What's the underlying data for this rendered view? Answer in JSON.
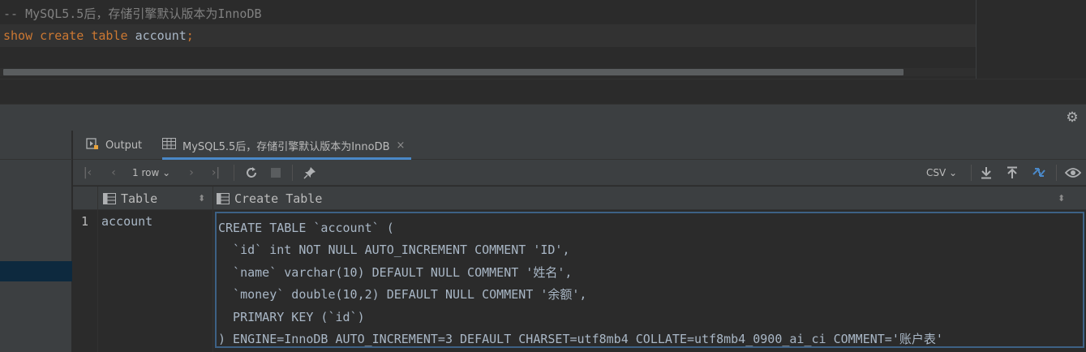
{
  "editor": {
    "comment": "-- MySQL5.5后，存储引擎默认版本为InnoDB",
    "query_kw1": "show",
    "query_kw2": "create",
    "query_kw3": "table",
    "query_ident": "account",
    "query_end": ";"
  },
  "tabs": [
    {
      "label": "Output",
      "icon": "run-output-icon"
    },
    {
      "label": "MySQL5.5后，存储引擎默认版本为InnoDB",
      "icon": "table-grid-icon",
      "close": "×"
    }
  ],
  "toolbar": {
    "rows_label": "1 row",
    "export_format": "CSV"
  },
  "grid": {
    "columns": [
      "Table",
      "Create Table"
    ],
    "rows": [
      {
        "num": "1",
        "table": "account",
        "create_table": [
          "CREATE TABLE `account` (",
          "  `id` int NOT NULL AUTO_INCREMENT COMMENT 'ID',",
          "  `name` varchar(10) DEFAULT NULL COMMENT '姓名',",
          "  `money` double(10,2) DEFAULT NULL COMMENT '余额',",
          "  PRIMARY KEY (`id`)",
          ") ENGINE=InnoDB AUTO_INCREMENT=3 DEFAULT CHARSET=utf8mb4 COLLATE=utf8mb4_0900_ai_ci COMMENT='账户表'"
        ]
      }
    ]
  },
  "colors": {
    "background": "#2b2b2b",
    "panel": "#3c3f41",
    "keyword": "#cc7832",
    "comment": "#808080",
    "selection_border": "#3d6185",
    "tab_underline": "#4a88c7"
  }
}
